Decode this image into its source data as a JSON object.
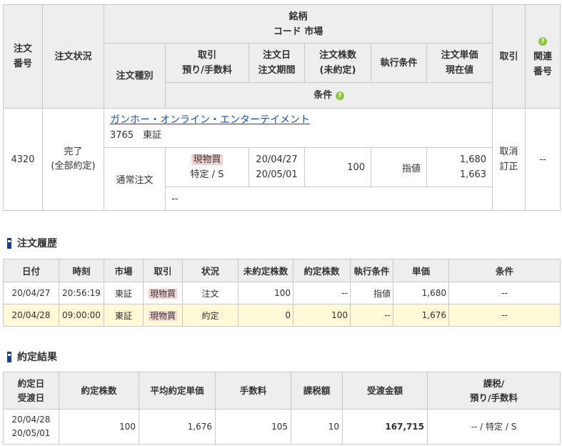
{
  "order": {
    "headers": {
      "order_no": [
        "注文",
        "番号"
      ],
      "status": "注文状況",
      "stock": [
        "銘柄",
        "コード 市場"
      ],
      "type": "注文種別",
      "trade": [
        "取引",
        "預り/手数料"
      ],
      "date": [
        "注文日",
        "注文期間"
      ],
      "qty": [
        "注文株数",
        "(未約定)"
      ],
      "exec": "執行条件",
      "price": [
        "注文単価",
        "現在値"
      ],
      "action": "取引",
      "condition": "条件",
      "related": [
        "関連",
        "番号"
      ],
      "hint": "?"
    },
    "row": {
      "order_no": "4320",
      "status": [
        "完了",
        "(全部約定)"
      ],
      "stock_name": "ガンホー・オンライン・エンターテイメント",
      "stock_code_market": "3765　東証",
      "type": "通常注文",
      "trade": "現物買",
      "account": "特定 / S",
      "order_date": "20/04/27",
      "period": "20/05/01",
      "qty": "100",
      "exec": "指値",
      "price": "1,680",
      "current": "1,663",
      "cancel": "取消",
      "modify": "訂正",
      "related": "--",
      "condition": "--"
    }
  },
  "history": {
    "title": "注文履歴",
    "headers": [
      "日付",
      "時刻",
      "市場",
      "取引",
      "状況",
      "未約定株数",
      "約定株数",
      "執行条件",
      "単価",
      "条件"
    ],
    "rows": [
      [
        "20/04/27",
        "20:56:19",
        "東証",
        "現物買",
        "注文",
        "100",
        "--",
        "指値",
        "1,680",
        "--"
      ],
      [
        "20/04/28",
        "09:00:00",
        "東証",
        "現物買",
        "約定",
        "0",
        "100",
        "--",
        "1,676",
        "--"
      ]
    ]
  },
  "result": {
    "title": "約定結果",
    "headers": {
      "date": [
        "約定日",
        "受渡日"
      ],
      "qty": "約定株数",
      "avg": "平均約定単価",
      "fee": "手数料",
      "tax": "課税額",
      "amount": "受渡金額",
      "type": [
        "課税/",
        "預り/手数料"
      ]
    },
    "row": {
      "exec_date": "20/04/28",
      "settle_date": "20/05/01",
      "qty": "100",
      "avg": "1,676",
      "fee": "105",
      "tax": "10",
      "amount": "167,715",
      "type": "-- / 特定 / S"
    }
  },
  "colors": {
    "header_bg": "#eeeeee",
    "border": "#c8c8c8",
    "link": "#1a4fa0",
    "buy_tag": "#f6d4d4",
    "highlight_row": "#fdf9d6",
    "marker": "#1a3f8f",
    "hint_icon": "#8cc63f"
  }
}
